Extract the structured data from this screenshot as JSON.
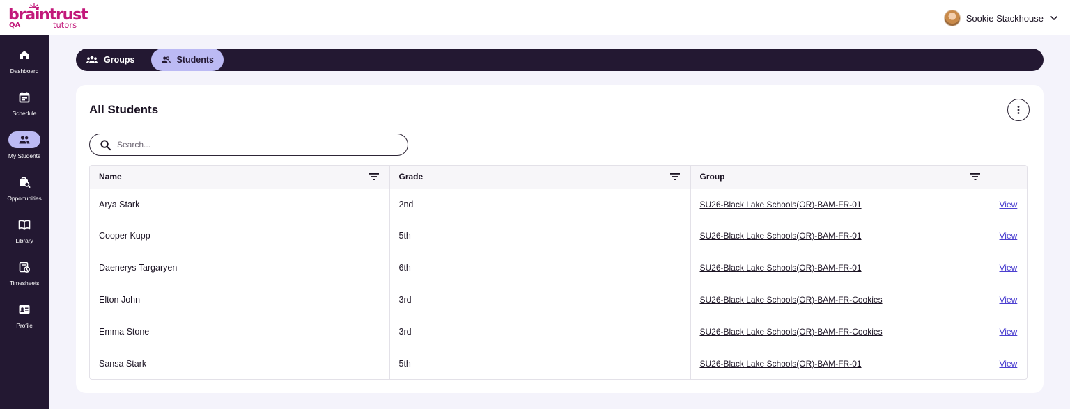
{
  "brand": {
    "name": "braintrust",
    "sub": "tutors",
    "env": "QA"
  },
  "user": {
    "name": "Sookie Stackhouse"
  },
  "sidebar": {
    "items": [
      {
        "label": "Dashboard",
        "icon": "home-icon"
      },
      {
        "label": "Schedule",
        "icon": "calendar-icon"
      },
      {
        "label": "My Students",
        "icon": "people-icon",
        "active": true
      },
      {
        "label": "Opportunities",
        "icon": "briefcase-search-icon"
      },
      {
        "label": "Library",
        "icon": "book-icon"
      },
      {
        "label": "Timesheets",
        "icon": "timesheet-icon"
      },
      {
        "label": "Profile",
        "icon": "id-card-icon"
      }
    ]
  },
  "tabs": [
    {
      "label": "Groups",
      "icon": "groups-icon",
      "active": false
    },
    {
      "label": "Students",
      "icon": "students-icon",
      "active": true
    }
  ],
  "main": {
    "title": "All Students",
    "search": {
      "placeholder": "Search...",
      "value": ""
    },
    "table": {
      "columns": [
        "Name",
        "Grade",
        "Group",
        ""
      ],
      "rows": [
        {
          "name": "Arya Stark",
          "grade": "2nd",
          "group": "SU26-Black Lake Schools(OR)-BAM-FR-01",
          "action": "View"
        },
        {
          "name": "Cooper Kupp",
          "grade": "5th",
          "group": "SU26-Black Lake Schools(OR)-BAM-FR-01",
          "action": "View"
        },
        {
          "name": "Daenerys Targaryen",
          "grade": "6th",
          "group": "SU26-Black Lake Schools(OR)-BAM-FR-01",
          "action": "View"
        },
        {
          "name": "Elton John",
          "grade": "3rd",
          "group": "SU26-Black Lake Schools(OR)-BAM-FR-Cookies",
          "action": "View"
        },
        {
          "name": "Emma Stone",
          "grade": "3rd",
          "group": "SU26-Black Lake Schools(OR)-BAM-FR-Cookies",
          "action": "View"
        },
        {
          "name": "Sansa Stark",
          "grade": "5th",
          "group": "SU26-Black Lake Schools(OR)-BAM-FR-01",
          "action": "View"
        }
      ]
    }
  },
  "colors": {
    "brand": "#c2187a",
    "sidebar_bg": "#231832",
    "active_pill": "#bcbaf4",
    "page_bg": "#f4f3fb",
    "link": "#4b3fd0"
  }
}
